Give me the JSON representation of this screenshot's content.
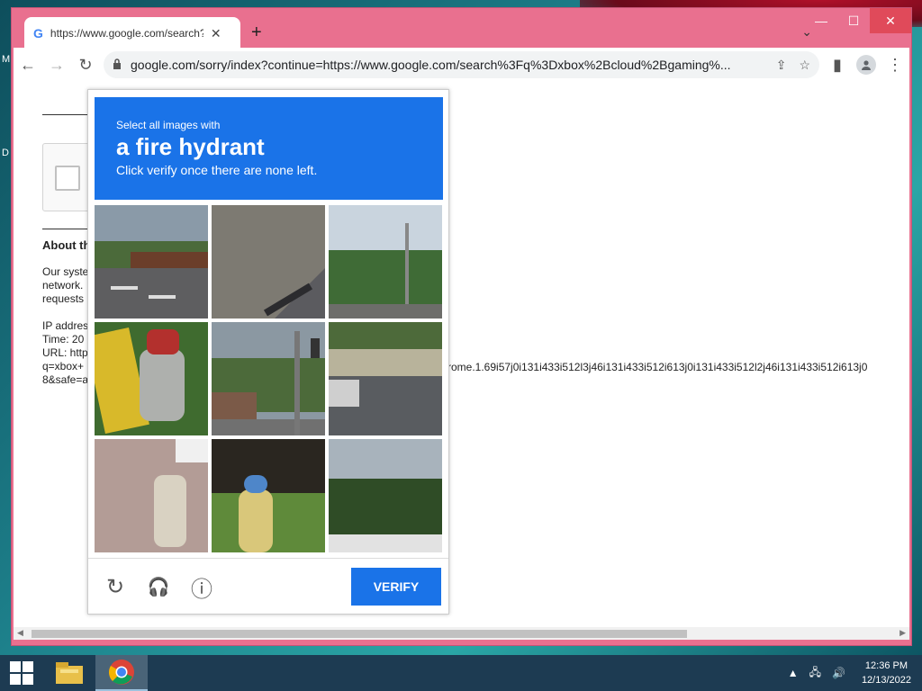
{
  "desktop": {
    "letters": [
      "M",
      "D"
    ]
  },
  "window": {
    "caption": {
      "minimize": "—",
      "maximize": "☐",
      "close": "✕"
    },
    "tab": {
      "favicon": "G",
      "title": "https://www.google.com/search?",
      "close": "✕"
    },
    "new_tab": "+",
    "tab_search": "⌄"
  },
  "toolbar": {
    "back": "←",
    "forward": "→",
    "reload": "↻",
    "url": "google.com/sorry/index?continue=https://www.google.com/search%3Fq%3Dxbox%2Bcloud%2Bgaming%...",
    "share": "⇪",
    "star": "☆",
    "sidepanel": "▮",
    "menu": "⋮"
  },
  "page": {
    "about_heading": "About th",
    "para1": [
      "Our syste",
      "network.",
      "requests"
    ],
    "para2": [
      "IP addres",
      "Time: 20",
      "URL: http",
      "q=xbox+",
      "8&safe=a"
    ],
    "url_tail": "rome.1.69i57j0i131i433i512l3j46i131i433i512i613j0i131i433i512l2j46i131i433i512i613j0"
  },
  "captcha": {
    "instruction": "Select all images with",
    "target": "a fire hydrant",
    "subtext": "Click verify once there are none left.",
    "reload_icon": "↻",
    "audio_icon": "🎧",
    "info_icon": "ⓘ",
    "verify_label": "VERIFY"
  },
  "taskbar": {
    "time": "12:36 PM",
    "date": "12/13/2022"
  }
}
